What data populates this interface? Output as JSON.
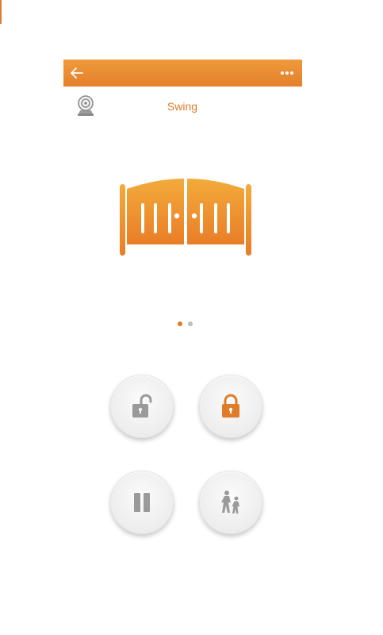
{
  "header": {
    "back_icon": "arrow-left-icon",
    "more_icon": "more-dots-icon",
    "color": "#e8862f"
  },
  "device": {
    "camera_icon": "camera-icon",
    "title": "Swing",
    "image_icon": "swing-gate-icon"
  },
  "pager": {
    "count": 2,
    "active_index": 0
  },
  "controls": [
    {
      "icon": "unlock-icon",
      "state": "inactive"
    },
    {
      "icon": "lock-icon",
      "state": "active"
    },
    {
      "icon": "pause-icon",
      "state": "inactive"
    },
    {
      "icon": "pedestrian-icon",
      "state": "inactive"
    }
  ],
  "colors": {
    "accent": "#e07b2a",
    "inactive_icon": "#9a9a9a"
  }
}
